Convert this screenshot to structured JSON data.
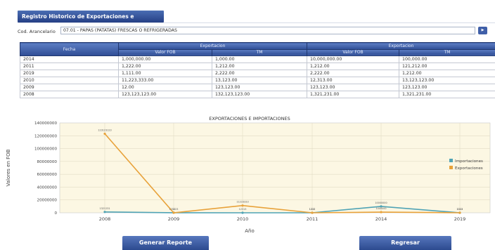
{
  "header": {
    "title": "Registro Historico de Exportaciones e Importaciones"
  },
  "filter": {
    "label": "Cod. Arancelario",
    "selected": "07.01 - PAPAS (PATATAS) FRESCAS O REFRIGERADAS"
  },
  "table": {
    "col_fecha": "Fecha",
    "group_left": "Exportacion",
    "group_right": "Exportacion",
    "sub_headers": [
      "Valor FOB",
      "TM",
      "Valor FOB",
      "TM"
    ],
    "rows": [
      [
        "2014",
        "1,000,000.00",
        "1,000.00",
        "10,000,000.00",
        "100,000.00"
      ],
      [
        "2011",
        "1,222.00",
        "1,212.00",
        "1,212.00",
        "121,212.00"
      ],
      [
        "2019",
        "1,111.00",
        "2,222.00",
        "2,222.00",
        "1,212.00"
      ],
      [
        "2010",
        "11,223,333.00",
        "13,123.00",
        "12,313.00",
        "13,123,123.00"
      ],
      [
        "2009",
        "12.00",
        "123,123.00",
        "123,123.00",
        "123,123.00"
      ],
      [
        "2008",
        "123,123,123.00",
        "132,123,123.00",
        "1,321,231.00",
        "1,321,231.00"
      ]
    ]
  },
  "chart_data": {
    "type": "line",
    "title": "EXPORTACIONES E IMPORTACIONES",
    "xlabel": "Año",
    "ylabel": "Valores en FOB",
    "categories": [
      "2008",
      "2009",
      "2010",
      "2011",
      "2014",
      "2019"
    ],
    "ylim": [
      0,
      140000000
    ],
    "yticks": [
      "140000000",
      "120000000",
      "100000000",
      "80000000",
      "60000000",
      "40000000",
      "20000000",
      "0"
    ],
    "grid": true,
    "legend": "right",
    "series": [
      {
        "name": "Importaciones",
        "color": "#4fa3b5",
        "values": [
          1321231,
          123123,
          12313,
          1212,
          10000000,
          2222
        ]
      },
      {
        "name": "Exportaciones",
        "color": "#e8a23a",
        "values": [
          123123123,
          12,
          11223333,
          1222,
          1000000,
          1111
        ]
      }
    ],
    "data_labels": {
      "Importaciones": [
        "1321231",
        "123123",
        "12313",
        "1212",
        "10000000",
        "2222"
      ],
      "Exportaciones": [
        "123123123",
        "12",
        "11223333",
        "1222",
        "1000000",
        "1111"
      ]
    }
  },
  "buttons": {
    "generar": "Generar Reporte",
    "regresar": "Regresar"
  }
}
